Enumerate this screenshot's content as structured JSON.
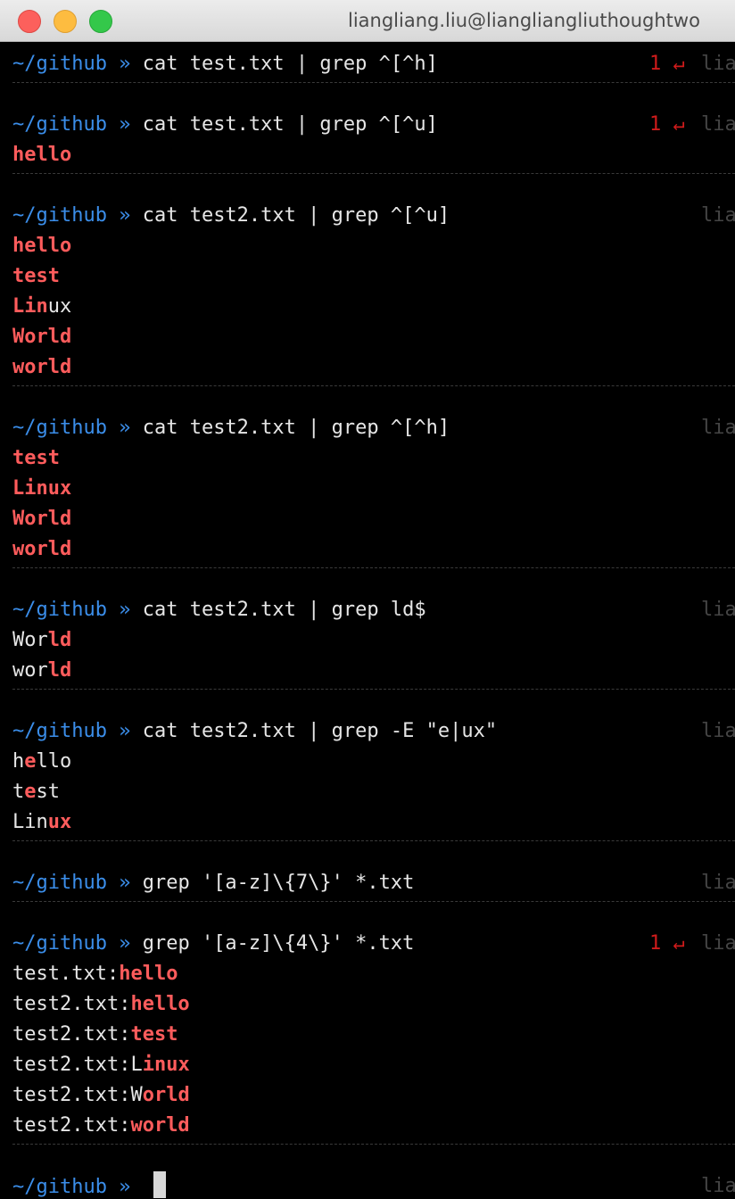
{
  "window": {
    "title": "liangliang.liu@liangliangliuthoughtwo"
  },
  "prompt": {
    "path": "~/github",
    "separator": "»",
    "right_prompt": "lia"
  },
  "blocks": [
    {
      "command": "cat test.txt | grep ^[^h]",
      "status": "1 ↵",
      "output": []
    },
    {
      "command": "cat test.txt | grep ^[^u]",
      "status": "1 ↵",
      "output": [
        {
          "pre": "",
          "m": "hello",
          "post": ""
        }
      ]
    },
    {
      "command": "cat test2.txt | grep ^[^u]",
      "status": "",
      "output": [
        {
          "pre": "",
          "m": "hello",
          "post": ""
        },
        {
          "pre": "",
          "m": "test",
          "post": ""
        },
        {
          "pre": "",
          "m": "Lin",
          "post": "ux"
        },
        {
          "pre": "",
          "m": "World",
          "post": ""
        },
        {
          "pre": "",
          "m": "world",
          "post": ""
        }
      ]
    },
    {
      "command": "cat test2.txt | grep ^[^h]",
      "status": "",
      "output": [
        {
          "pre": "",
          "m": "test",
          "post": ""
        },
        {
          "pre": "",
          "m": "Linux",
          "post": ""
        },
        {
          "pre": "",
          "m": "World",
          "post": ""
        },
        {
          "pre": "",
          "m": "world",
          "post": ""
        }
      ]
    },
    {
      "command": "cat test2.txt | grep ld$",
      "status": "",
      "output": [
        {
          "pre": "Wor",
          "m": "ld",
          "post": ""
        },
        {
          "pre": "wor",
          "m": "ld",
          "post": ""
        }
      ]
    },
    {
      "command": "cat test2.txt | grep -E \"e|ux\"",
      "status": "",
      "output": [
        {
          "pre": "h",
          "m": "e",
          "post": "llo"
        },
        {
          "pre": "t",
          "m": "e",
          "post": "st"
        },
        {
          "pre": "Lin",
          "m": "ux",
          "post": ""
        }
      ]
    },
    {
      "command": "grep '[a-z]\\{7\\}' *.txt",
      "status": "",
      "output": []
    },
    {
      "command": "grep '[a-z]\\{4\\}' *.txt",
      "status": "1 ↵",
      "output": [
        {
          "pre": "test.txt:",
          "m": "hello",
          "post": ""
        },
        {
          "pre": "test2.txt:",
          "m": "hello",
          "post": ""
        },
        {
          "pre": "test2.txt:",
          "m": "test",
          "post": ""
        },
        {
          "pre": "test2.txt:L",
          "m": "inux",
          "post": ""
        },
        {
          "pre": "test2.txt:W",
          "m": "orld",
          "post": ""
        },
        {
          "pre": "test2.txt:",
          "m": "world",
          "post": ""
        }
      ]
    }
  ]
}
